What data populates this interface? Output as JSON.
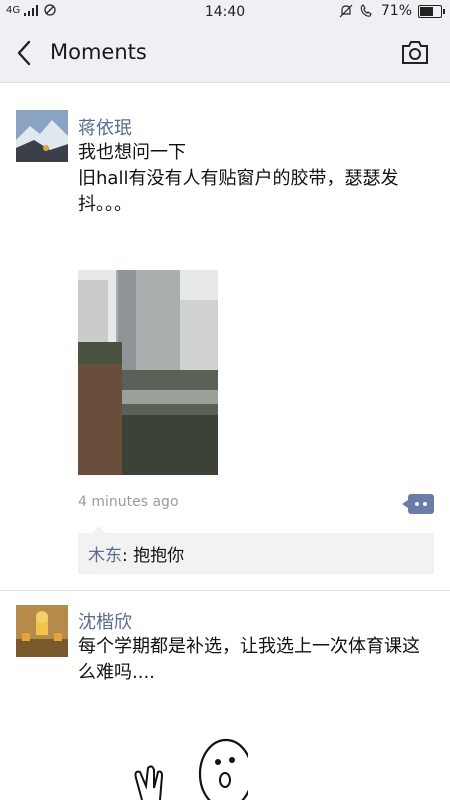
{
  "status_bar": {
    "signal_text": "4G",
    "time": "14:40",
    "battery_percent": "71%",
    "battery_level": 0.71
  },
  "nav": {
    "title": "Moments"
  },
  "posts": [
    {
      "author": "蒋依珉",
      "text": "我也想问一下\n旧hall有没有人有贴窗户的胶带，瑟瑟发抖。。。",
      "time_ago": "4 minutes ago",
      "comments": [
        {
          "author": "木东",
          "text": ": 抱抱你"
        }
      ]
    },
    {
      "author": "沈楷欣",
      "text": "每个学期都是补选，让我选上一次体育课这么难吗...."
    }
  ]
}
